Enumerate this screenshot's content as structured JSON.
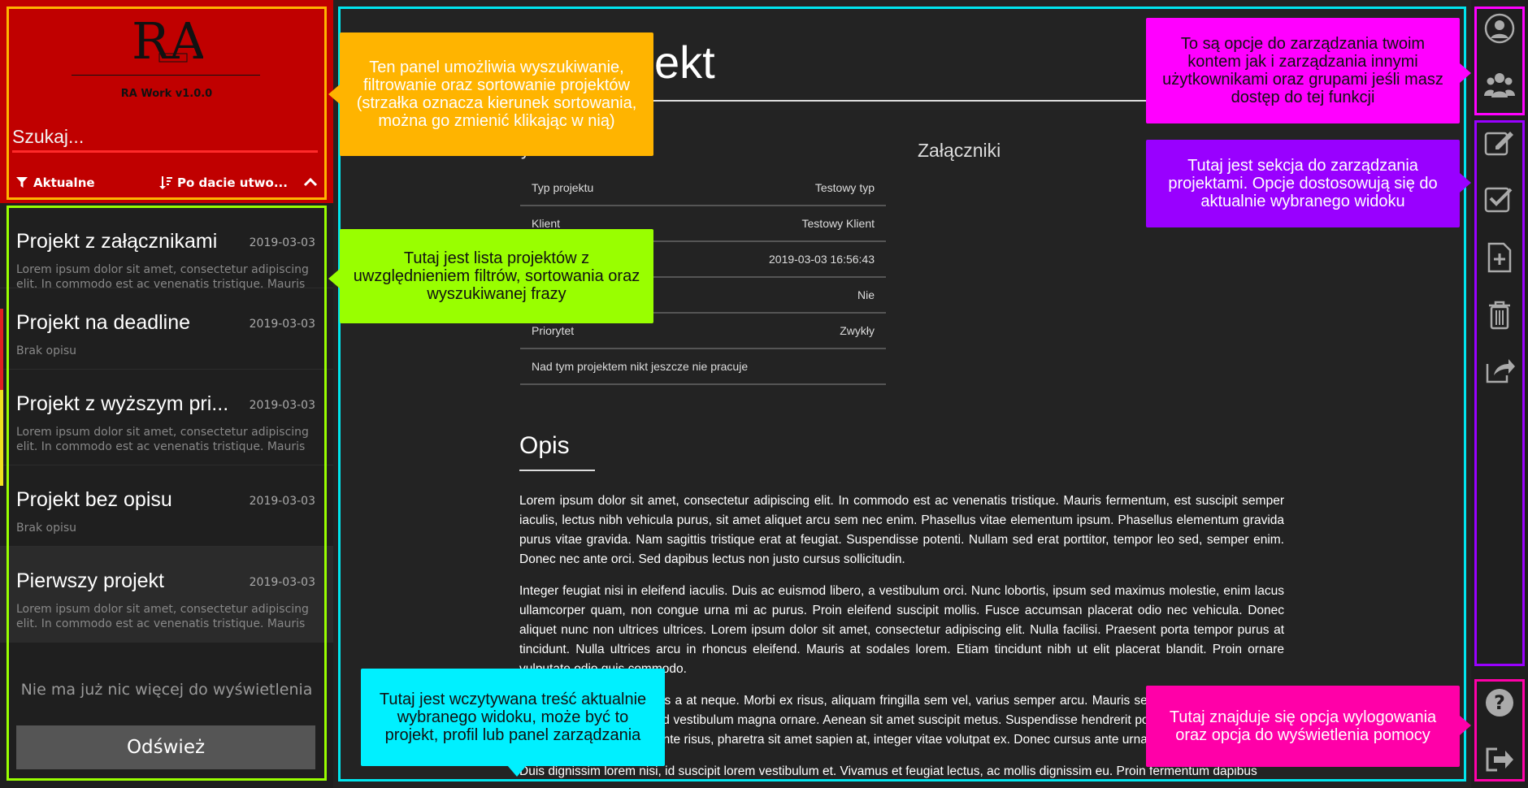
{
  "app": {
    "logo_text": "RA",
    "version": "RA Work v1.0.0"
  },
  "search": {
    "placeholder": "Szukaj..."
  },
  "filters": {
    "filter_label": "Aktualne",
    "sort_label": "Po dacie utwo..."
  },
  "projects": [
    {
      "title": "Projekt z załącznikami",
      "date": "2019-03-03",
      "desc": "Lorem ipsum dolor sit amet, consectetur adipiscing elit. In commodo est ac venenatis tristique. Mauris fermentum,..."
    },
    {
      "title": "Projekt na deadline",
      "date": "2019-03-03",
      "desc": "Brak opisu"
    },
    {
      "title": "Projekt z wyższym pri...",
      "date": "2019-03-03",
      "desc": "Lorem ipsum dolor sit amet, consectetur adipiscing elit. In commodo est ac venenatis tristique. Mauris fermentum,..."
    },
    {
      "title": "Projekt bez opisu",
      "date": "2019-03-03",
      "desc": "Brak opisu"
    },
    {
      "title": "Pierwszy projekt",
      "date": "2019-03-03",
      "desc": "Lorem ipsum dolor sit amet, consectetur adipiscing elit. In commodo est ac venenatis tristique. Mauris fermentum,..."
    }
  ],
  "list_end_text": "Nie ma już nic więcej do wyświetlenia",
  "refresh_label": "Odśwież",
  "main": {
    "title": "zy projekt",
    "details_heading": "y",
    "attachments_heading": "Załączniki",
    "details": [
      {
        "label": "Typ projektu",
        "value": "Testowy typ"
      },
      {
        "label": "Klient",
        "value": "Testowy Klient"
      },
      {
        "label": "",
        "value": "2019-03-03 16:56:43"
      },
      {
        "label": "",
        "value": "Nie"
      },
      {
        "label": "Priorytet",
        "value": "Zwykły"
      },
      {
        "label": "Nad tym projektem nikt jeszcze nie pracuje",
        "value": ""
      }
    ],
    "desc_heading": "Opis",
    "desc_paragraphs": [
      "Lorem ipsum dolor sit amet, consectetur adipiscing elit. In commodo est ac venenatis tristique. Mauris fermentum, est suscipit semper iaculis, lectus nibh vehicula purus, sit amet aliquet arcu sem nec enim. Phasellus vitae elementum ipsum. Phasellus elementum gravida purus vitae gravida. Nam sagittis tristique erat at feugiat. Suspendisse potenti. Nullam sed erat porttitor, tempor leo sed, semper enim. Donec nec ante orci. Sed dapibus lectus non justo cursus sollicitudin.",
      "Integer feugiat nisi in eleifend iaculis. Duis ac euismod libero, a vestibulum orci. Nunc lobortis, ipsum sed maximus molestie, enim lacus ullamcorper quam, non congue urna mi ac purus. Proin eleifend suscipit mollis. Fusce accumsan placerat odio nec vehicula. Donec aliquet nunc non ultrices ultrices. Lorem ipsum dolor sit amet, consectetur adipiscing elit. Nulla facilisi. Praesent porta tempor purus at tincidunt. Nulla ultrices arcu in rhoncus eleifend. Mauris at sodales lorem. Etiam tincidunt nibh ut elit placerat blandit. Proin ornare vulputate odio quis commodo.",
      "Vestibulum et ligula cursus a at neque. Morbi ex risus, aliquam fringilla sem vel, varius semper arcu. Mauris sed lacinia nibh. Ut cursus ipsum ut elit malesuada, id vestibulum magna ornare. Aenean sit amet suscipit metus. Suspendisse hendrerit posuere orci, ac commodo massa vehicula ut. Duis ante risus, pharetra sit amet sapien at, integer vitae volutpat ex. Donec cursus ante urna.",
      "Duis dignissim lorem nisi, id suscipit lorem vestibulum et. Vivamus et feugiat lectus, ac mollis dignissim eu. Proin fermentum dapibus"
    ]
  },
  "tips": {
    "search": "Ten panel umożliwia wyszukiwanie, filtrowanie oraz sortowanie projektów (strzałka oznacza kierunek sortowania, można go zmienić klikając w nią)",
    "list": "Tutaj jest lista projektów z uwzględnieniem filtrów, sortowania oraz wyszukiwanej frazy",
    "content": "Tutaj jest wczytywana treść aktualnie wybranego widoku, może być to projekt, profil lub panel zarządzania",
    "account": "To są opcje do zarządzania twoim kontem jak i zarządzania innymi użytkownikami oraz grupami jeśli masz dostęp do tej funkcji",
    "projects": "Tutaj jest sekcja do zarządzania projektami. Opcje dostosowują się do aktualnie wybranego widoku",
    "logout": "Tutaj znajduje się opcja wylogowania oraz opcja do wyświetlenia pomocy"
  },
  "colors": {
    "search_panel": "#c00000",
    "tip_orange": "#ffb400",
    "tip_green": "#99ff00",
    "tip_cyan": "#00f0ff",
    "tip_magenta": "#ff00ff",
    "tip_purple": "#9900ff",
    "tip_pink": "#ff00a8"
  },
  "icons": [
    "user-icon",
    "users-icon",
    "edit-icon",
    "check-icon",
    "add-file-icon",
    "trash-icon",
    "share-icon",
    "help-icon",
    "logout-icon",
    "filter-icon",
    "sort-icon",
    "chevron-up-icon"
  ]
}
